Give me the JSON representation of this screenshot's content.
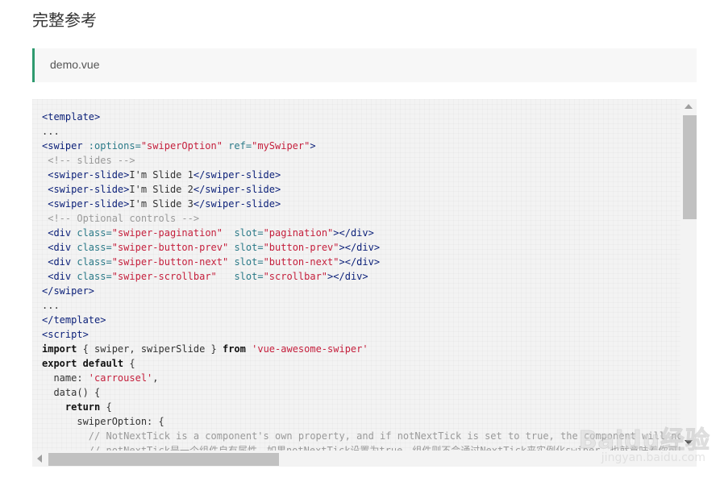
{
  "section": {
    "title": "完整参考"
  },
  "file": {
    "name": "demo.vue"
  },
  "code": {
    "lines": [
      [
        [
          "t",
          "<template>"
        ]
      ],
      [
        [
          "p",
          "..."
        ]
      ],
      [
        [
          "t",
          "<swiper "
        ],
        [
          "a",
          ":options="
        ],
        [
          "s",
          "\"swiperOption\""
        ],
        [
          "a",
          " ref="
        ],
        [
          "s",
          "\"mySwiper\""
        ],
        [
          "t",
          ">"
        ]
      ],
      [
        [
          "c",
          " <!-- slides -->"
        ]
      ],
      [
        [
          "t",
          " <swiper-slide>"
        ],
        [
          "p",
          "I'm Slide 1"
        ],
        [
          "t",
          "</swiper-slide>"
        ]
      ],
      [
        [
          "t",
          " <swiper-slide>"
        ],
        [
          "p",
          "I'm Slide 2"
        ],
        [
          "t",
          "</swiper-slide>"
        ]
      ],
      [
        [
          "t",
          " <swiper-slide>"
        ],
        [
          "p",
          "I'm Slide 3"
        ],
        [
          "t",
          "</swiper-slide>"
        ]
      ],
      [
        [
          "c",
          " <!-- Optional controls -->"
        ]
      ],
      [
        [
          "t",
          " <div "
        ],
        [
          "a",
          "class="
        ],
        [
          "s",
          "\"swiper-pagination\""
        ],
        [
          "a",
          "  slot="
        ],
        [
          "s",
          "\"pagination\""
        ],
        [
          "t",
          "></div>"
        ]
      ],
      [
        [
          "t",
          " <div "
        ],
        [
          "a",
          "class="
        ],
        [
          "s",
          "\"swiper-button-prev\""
        ],
        [
          "a",
          " slot="
        ],
        [
          "s",
          "\"button-prev\""
        ],
        [
          "t",
          "></div>"
        ]
      ],
      [
        [
          "t",
          " <div "
        ],
        [
          "a",
          "class="
        ],
        [
          "s",
          "\"swiper-button-next\""
        ],
        [
          "a",
          " slot="
        ],
        [
          "s",
          "\"button-next\""
        ],
        [
          "t",
          "></div>"
        ]
      ],
      [
        [
          "t",
          " <div "
        ],
        [
          "a",
          "class="
        ],
        [
          "s",
          "\"swiper-scrollbar\""
        ],
        [
          "a",
          "   slot="
        ],
        [
          "s",
          "\"scrollbar\""
        ],
        [
          "t",
          "></div>"
        ]
      ],
      [
        [
          "t",
          "</swiper>"
        ]
      ],
      [
        [
          "p",
          "..."
        ]
      ],
      [
        [
          "t",
          "</template>"
        ]
      ],
      [
        [
          "t",
          "<script>"
        ]
      ],
      [
        [
          "k",
          "import"
        ],
        [
          "p",
          " { swiper, swiperSlide } "
        ],
        [
          "k",
          "from"
        ],
        [
          "v",
          " 'vue-awesome-swiper'"
        ]
      ],
      [
        [
          "k",
          "export default"
        ],
        [
          "p",
          " {"
        ]
      ],
      [
        [
          "p",
          "  name: "
        ],
        [
          "v",
          "'carrousel'"
        ],
        [
          "p",
          ","
        ]
      ],
      [
        [
          "p",
          "  data() {"
        ]
      ],
      [
        [
          "k",
          "    return"
        ],
        [
          "p",
          " {"
        ]
      ],
      [
        [
          "p",
          "      swiperOption: {"
        ]
      ],
      [
        [
          "c",
          "        // NotNextTick is a component's own property, and if notNextTick is set to true, the component will not instant"
        ]
      ],
      [
        [
          "c",
          "        // notNextTick是一个组件自有属性，如果notNextTick设置为true，组件则不会通过NextTick来实例化swiper，也就意味着你可以"
        ]
      ]
    ]
  },
  "watermark": {
    "brand": "Baidu经验",
    "url": "jingyan.baidu.com"
  },
  "icons": {
    "scroll_up": "arrow-up-icon",
    "scroll_down": "arrow-down-icon",
    "scroll_left": "arrow-left-icon",
    "scroll_right": "arrow-right-icon"
  },
  "colors": {
    "accent": "#2e9a6e",
    "tag": "#0a1f78",
    "attr": "#2b7a88",
    "string": "#c51f3c",
    "comment": "#9a9a9a"
  }
}
